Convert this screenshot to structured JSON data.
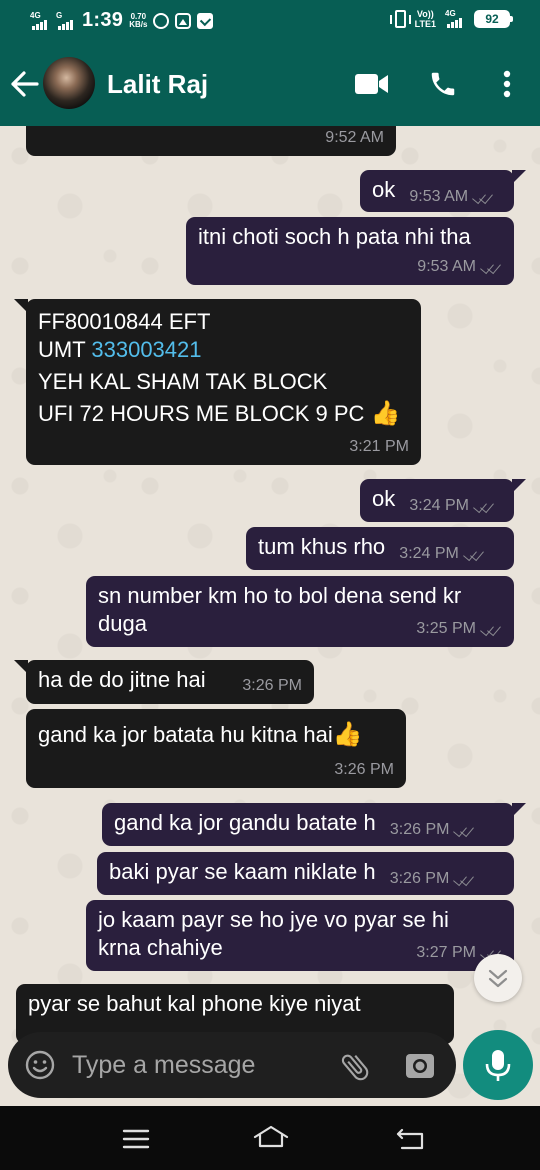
{
  "status_bar": {
    "sim1_label": "4G",
    "sim2_label": "G",
    "time": "1:39",
    "speed_value": "0.70",
    "speed_unit": "KB/s",
    "volte_top": "Vo))",
    "volte_bottom": "LTE1",
    "net_label": "4G",
    "battery": "92"
  },
  "header": {
    "contact_name": "Lalit Raj"
  },
  "messages": [
    {
      "dir": "in",
      "lines": [],
      "time": "9:52 AM"
    },
    {
      "dir": "out",
      "lines": [
        "ok"
      ],
      "time": "9:53 AM"
    },
    {
      "dir": "out",
      "lines": [
        "itni choti soch h pata nhi tha"
      ],
      "time": "9:53 AM"
    },
    {
      "dir": "in",
      "lines": [
        "FF80010844 EFT",
        "UMT ",
        "YEH KAL SHAM TAK BLOCK",
        "UFI 72 HOURS ME BLOCK 9 PC"
      ],
      "link": "333003421",
      "time": "3:21 PM"
    },
    {
      "dir": "out",
      "lines": [
        "ok"
      ],
      "time": "3:24 PM"
    },
    {
      "dir": "out",
      "lines": [
        "tum khus rho"
      ],
      "time": "3:24 PM"
    },
    {
      "dir": "out",
      "lines": [
        "sn number km ho to bol dena send kr",
        "duga"
      ],
      "time": "3:25 PM"
    },
    {
      "dir": "in",
      "lines": [
        "ha de do jitne hai"
      ],
      "time": "3:26 PM"
    },
    {
      "dir": "in",
      "lines": [
        "gand ka jor batata hu kitna hai"
      ],
      "time": "3:26 PM"
    },
    {
      "dir": "out",
      "lines": [
        "gand ka jor gandu batate h"
      ],
      "time": "3:26 PM"
    },
    {
      "dir": "out",
      "lines": [
        "baki pyar se kaam niklate h"
      ],
      "time": "3:26 PM"
    },
    {
      "dir": "out",
      "lines": [
        "jo kaam payr se ho jye vo pyar se hi",
        "krna chahiye"
      ],
      "time": "3:27 PM"
    },
    {
      "dir": "in",
      "lines": [
        "pyar se bahut kal phone kiye niyat"
      ],
      "time": ""
    }
  ],
  "input": {
    "placeholder": "Type a message"
  },
  "icons": {
    "back": "back-arrow-icon",
    "video": "video-call-icon",
    "call": "phone-icon",
    "menu": "more-vert-icon",
    "emoji": "emoji-icon",
    "attach": "paperclip-icon",
    "camera": "camera-icon",
    "mic": "mic-icon",
    "thumbs_up": "thumbs-up-emoji"
  },
  "colors": {
    "header": "#075e54",
    "incoming_bubble": "#1a1a1a",
    "outgoing_bubble": "#2a1f3d",
    "link": "#53bdeb",
    "mic_button": "#128c7e"
  }
}
